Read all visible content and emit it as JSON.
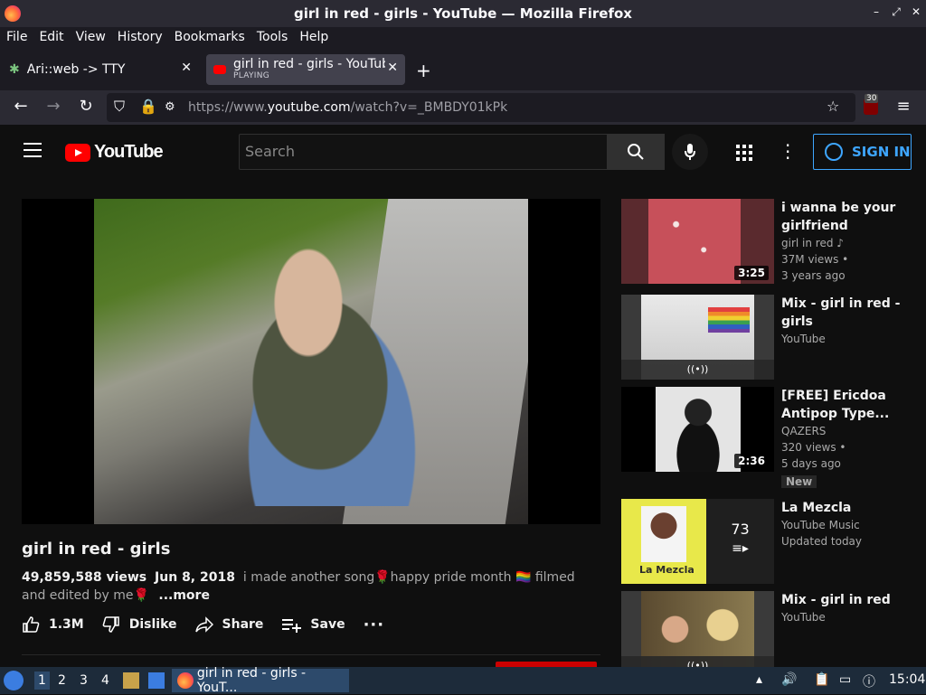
{
  "window": {
    "title": "girl in red - girls - YouTube — Mozilla Firefox"
  },
  "menu": [
    "File",
    "Edit",
    "View",
    "History",
    "Bookmarks",
    "Tools",
    "Help"
  ],
  "tabs": [
    {
      "label": "Ari::web -> TTY"
    },
    {
      "label": "girl in red - girls - YouTube",
      "sub": "PLAYING"
    }
  ],
  "address": {
    "prefix": "https://www.",
    "domain": "youtube.com",
    "path": "/watch?v=_BMBDY01kPk",
    "ublock_count": "30"
  },
  "youtube": {
    "logo_text": "YouTube",
    "search_placeholder": "Search",
    "sign_in": "SIGN IN"
  },
  "video": {
    "title": "girl in red - girls",
    "views": "49,859,588 views",
    "date": "Jun 8, 2018",
    "description": "i made another song🌹happy pride month 🏳️‍🌈 filmed and edited by me🌹",
    "more": "...more",
    "likes": "1.3M",
    "dislike": "Dislike",
    "share": "Share",
    "save": "Save"
  },
  "recommendations": [
    {
      "title": "i wanna be your girlfriend",
      "channel": "girl in red",
      "views": "37M views •",
      "age": "3 years ago",
      "duration": "3:25"
    },
    {
      "title": "Mix - girl in red - girls",
      "channel": "YouTube"
    },
    {
      "title": "[FREE] Ericdoa Antipop Type...",
      "channel": "QAZERS",
      "views": "320 views •",
      "age": "5 days ago",
      "duration": "2:36",
      "badge": "New"
    },
    {
      "title": "La Mezcla",
      "channel": "YouTube Music",
      "age": "Updated today",
      "count": "73",
      "thumb_label": "La Mezcla"
    },
    {
      "title": "Mix - girl in red",
      "channel": "YouTube"
    }
  ],
  "taskbar": {
    "workspaces": [
      "1",
      "2",
      "3",
      "4"
    ],
    "task": "girl in red - girls - YouT...",
    "clock": "15:04"
  }
}
